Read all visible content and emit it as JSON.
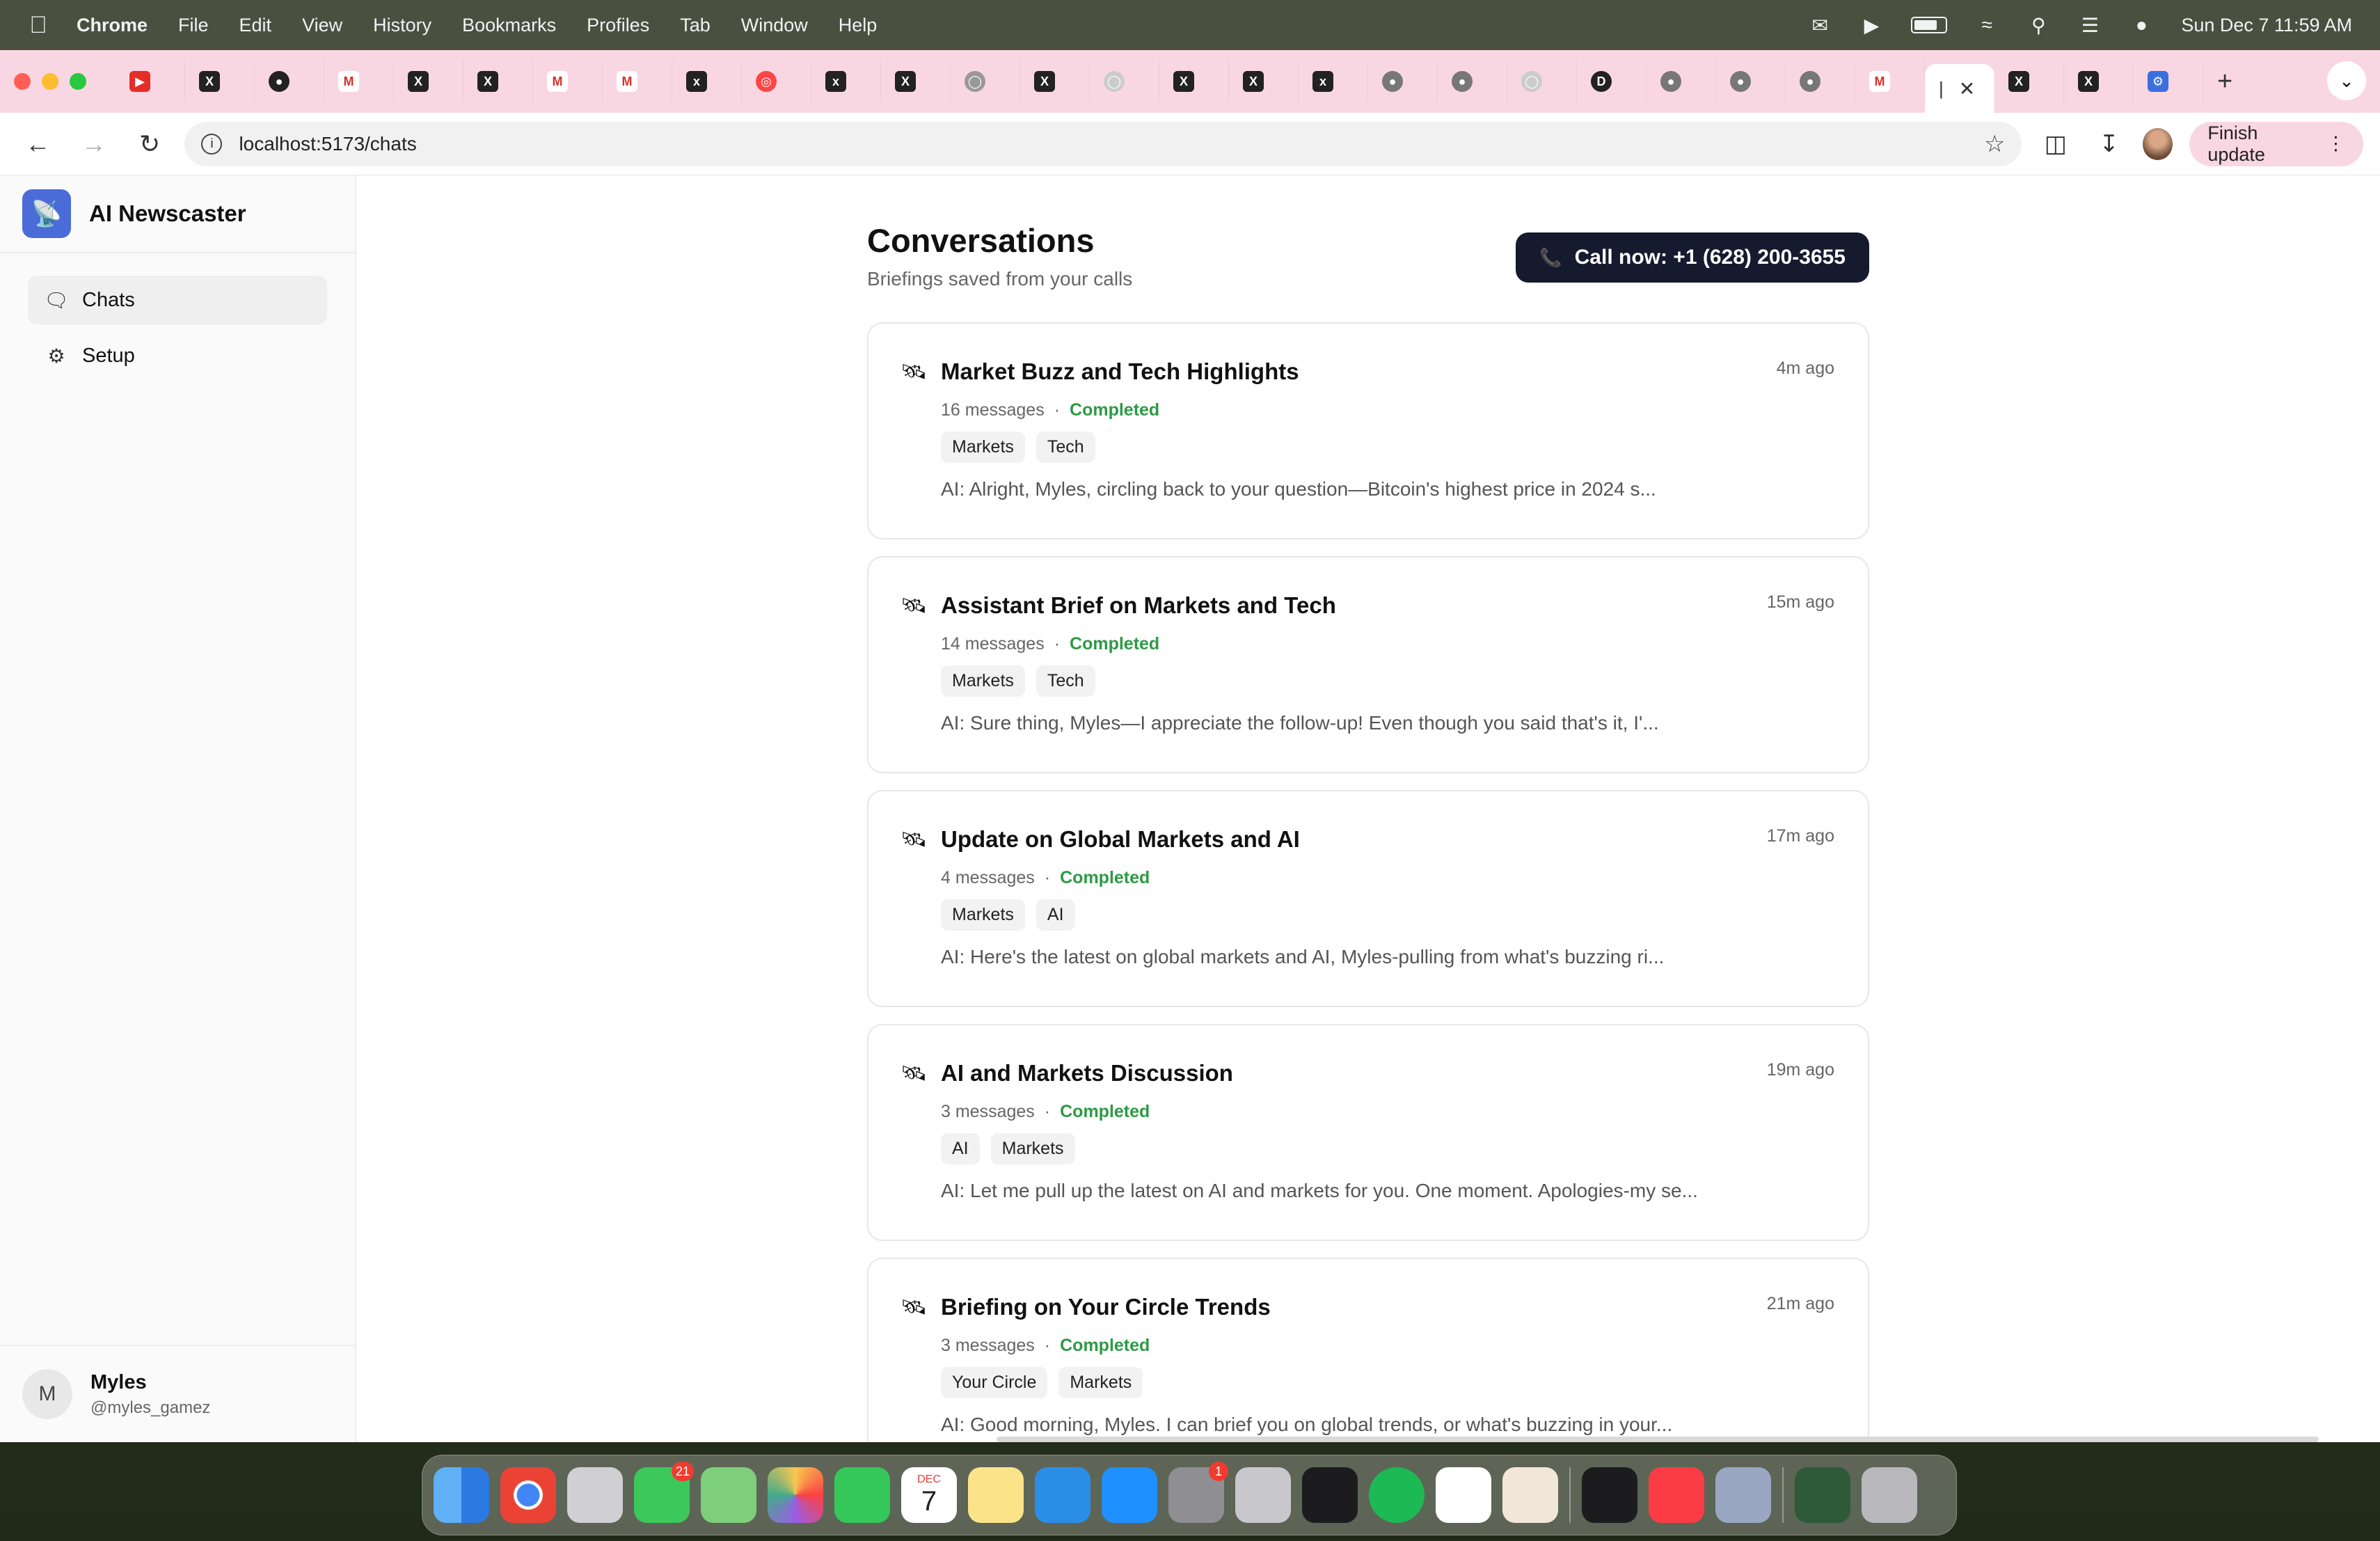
{
  "menubar": {
    "app": "Chrome",
    "items": [
      "File",
      "Edit",
      "View",
      "History",
      "Bookmarks",
      "Profiles",
      "Tab",
      "Window",
      "Help"
    ],
    "datetime": "Sun Dec 7  11:59 AM"
  },
  "browser": {
    "url": "localhost:5173/chats",
    "finish_update": "Finish update"
  },
  "app": {
    "name": "AI Newscaster",
    "nav": [
      {
        "label": "Chats"
      },
      {
        "label": "Setup"
      }
    ],
    "user": {
      "initial": "M",
      "name": "Myles",
      "handle": "@myles_gamez"
    }
  },
  "page": {
    "title": "Conversations",
    "subtitle": "Briefings saved from your calls",
    "call_button": "Call now: +1 (628) 200-3655"
  },
  "conversations": [
    {
      "title": "Market Buzz and Tech Highlights",
      "time": "4m ago",
      "messages": "16 messages",
      "status": "Completed",
      "tags": [
        "Markets",
        "Tech"
      ],
      "preview": "AI: Alright, Myles, circling back to your question—Bitcoin's highest price in 2024 s..."
    },
    {
      "title": "Assistant Brief on Markets and Tech",
      "time": "15m ago",
      "messages": "14 messages",
      "status": "Completed",
      "tags": [
        "Markets",
        "Tech"
      ],
      "preview": "AI: Sure thing, Myles—I appreciate the follow-up! Even though you said that's it, I'..."
    },
    {
      "title": "Update on Global Markets and AI",
      "time": "17m ago",
      "messages": "4 messages",
      "status": "Completed",
      "tags": [
        "Markets",
        "AI"
      ],
      "preview": "AI: Here's the latest on global markets and AI, Myles-pulling from what's buzzing ri..."
    },
    {
      "title": "AI and Markets Discussion",
      "time": "19m ago",
      "messages": "3 messages",
      "status": "Completed",
      "tags": [
        "AI",
        "Markets"
      ],
      "preview": "AI: Let me pull up the latest on AI and markets for you. One moment. Apologies-my se..."
    },
    {
      "title": "Briefing on Your Circle Trends",
      "time": "21m ago",
      "messages": "3 messages",
      "status": "Completed",
      "tags": [
        "Your Circle",
        "Markets"
      ],
      "preview": "AI: Good morning, Myles. I can brief you on global trends, or what's buzzing in your..."
    }
  ],
  "dock": {
    "badges": {
      "messages": "21",
      "settings": "1"
    },
    "calendar": {
      "month": "DEC",
      "day": "7"
    }
  },
  "colors": {
    "status_completed": "#2e9a46",
    "call_button_bg": "#161a2e",
    "tabstrip": "#f9d7e2"
  }
}
